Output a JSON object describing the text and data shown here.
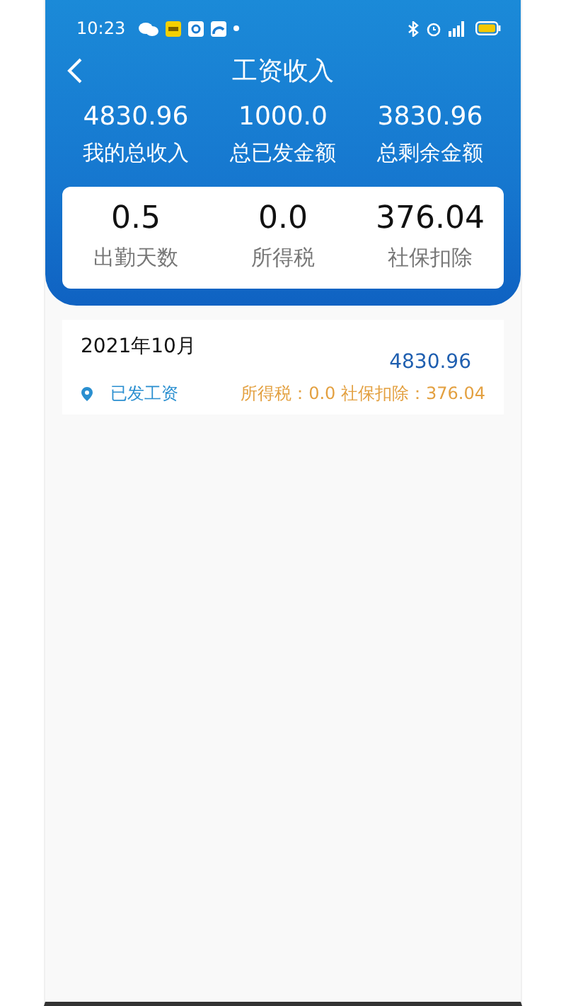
{
  "status_bar": {
    "time": "10:23"
  },
  "nav": {
    "title": "工资收入"
  },
  "summary": [
    {
      "value": "4830.96",
      "label": "我的总收入"
    },
    {
      "value": "1000.0",
      "label": "总已发金额"
    },
    {
      "value": "3830.96",
      "label": "总剩余金额"
    }
  ],
  "stats": [
    {
      "value": "0.5",
      "label": "出勤天数"
    },
    {
      "value": "0.0",
      "label": "所得税"
    },
    {
      "value": "376.04",
      "label": "社保扣除"
    }
  ],
  "records": [
    {
      "month": "2021年10月",
      "amount": "4830.96",
      "status": "已发工资",
      "detail": "所得税：0.0 社保扣除：376.04"
    }
  ]
}
